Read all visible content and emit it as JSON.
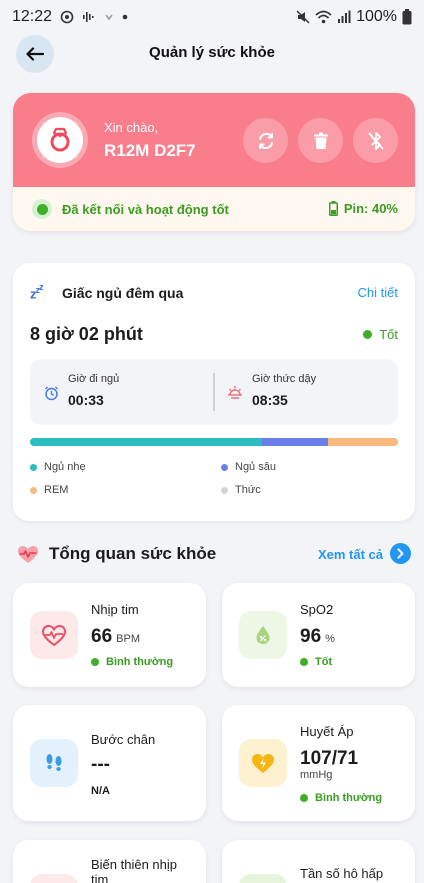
{
  "status_bar": {
    "time": "12:22",
    "battery": "100%"
  },
  "header": {
    "title": "Quản lý sức khỏe"
  },
  "device": {
    "greeting": "Xin chào,",
    "name": "R12M D2F7",
    "connection_status": "Đã kết nối và hoạt động tốt",
    "battery_label": "Pin: 40%",
    "battery_level": 0.4,
    "accent_color": "#f97d8b"
  },
  "sleep": {
    "title": "Giấc ngủ đêm qua",
    "detail_link": "Chi tiết",
    "duration": "8 giờ 02 phút",
    "quality": "Tốt",
    "bedtime_label": "Giờ đi ngủ",
    "bedtime": "00:33",
    "wake_label": "Giờ thức dậy",
    "wake": "08:35",
    "stages": [
      {
        "name": "Ngủ nhẹ",
        "color": "#2bbdc1",
        "fraction": 0.63
      },
      {
        "name": "Ngủ sâu",
        "color": "#6a7fe8",
        "fraction": 0.18
      },
      {
        "name": "REM",
        "color": "#f7b97c",
        "fraction": 0.19
      },
      {
        "name": "Thức",
        "color": "#d4d4d8",
        "fraction": 0.0
      }
    ]
  },
  "overview": {
    "title": "Tổng quan sức khỏe",
    "see_all": "Xem tất cả"
  },
  "metrics": {
    "heart_rate": {
      "label": "Nhịp tim",
      "value": "66",
      "unit": "BPM",
      "status": "Bình thường"
    },
    "spo2": {
      "label": "SpO2",
      "value": "96",
      "unit": "%",
      "status": "Tốt"
    },
    "steps": {
      "label": "Bước chân",
      "value": "---",
      "sub": "N/A"
    },
    "blood_pressure": {
      "label": "Huyết Áp",
      "value": "107/71",
      "unit": "mmHg",
      "status": "Bình thường"
    },
    "hrv": {
      "label_line1": "Biến thiên nhịp",
      "label_line2": "tim"
    },
    "resp_rate": {
      "label": "Tần số hô hấp"
    }
  }
}
